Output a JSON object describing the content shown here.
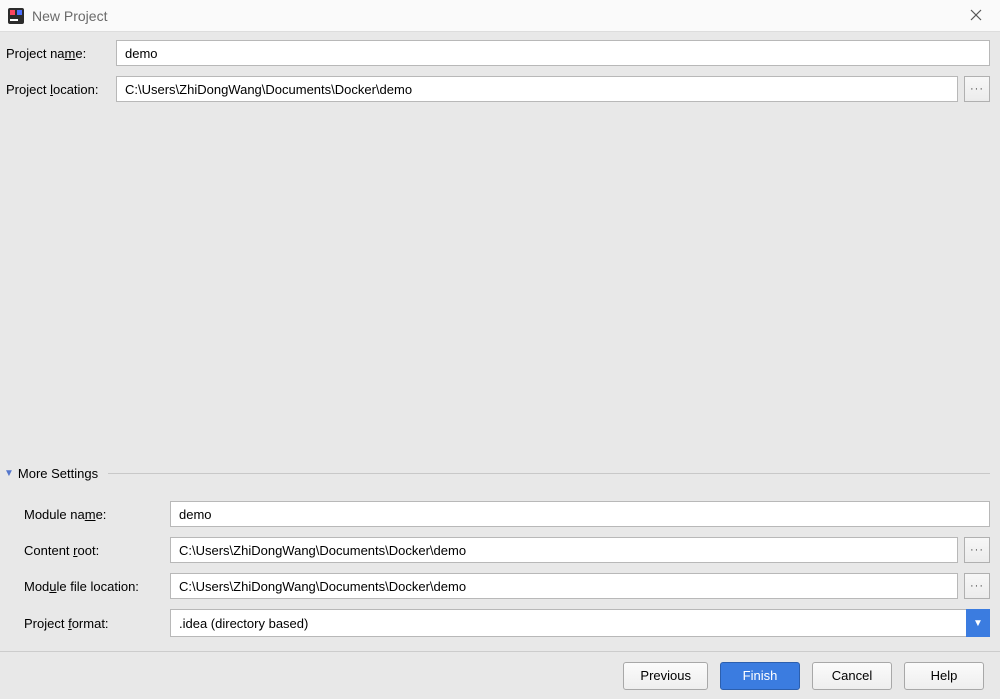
{
  "window": {
    "title": "New Project"
  },
  "fields": {
    "project_name": {
      "label": "Project name:",
      "value": "demo"
    },
    "project_location": {
      "label": "Project location:",
      "value": "C:\\Users\\ZhiDongWang\\Documents\\Docker\\demo"
    }
  },
  "more_settings": {
    "header": "More Settings",
    "module_name": {
      "label": "Module name:",
      "value": "demo"
    },
    "content_root": {
      "label": "Content root:",
      "value": "C:\\Users\\ZhiDongWang\\Documents\\Docker\\demo"
    },
    "module_file_location": {
      "label": "Module file location:",
      "value": "C:\\Users\\ZhiDongWang\\Documents\\Docker\\demo"
    },
    "project_format": {
      "label": "Project format:",
      "selected": ".idea (directory based)"
    }
  },
  "buttons": {
    "previous": "Previous",
    "finish": "Finish",
    "cancel": "Cancel",
    "help": "Help"
  }
}
